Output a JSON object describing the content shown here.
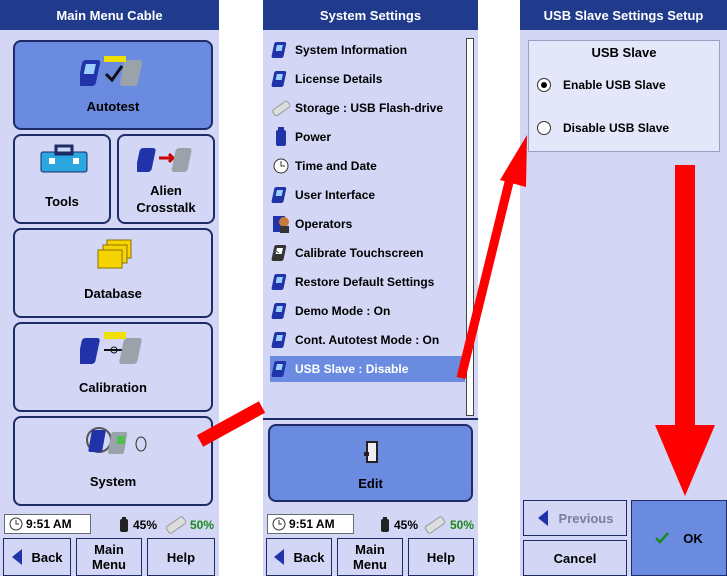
{
  "panel1": {
    "title": "Main Menu Cable",
    "buttons": [
      {
        "label": "Autotest",
        "icon": "autotest-icon"
      },
      {
        "label": "Tools",
        "icon": "toolbox-icon"
      },
      {
        "label": "Alien\nCrosstalk",
        "icon": "alien-crosstalk-icon"
      },
      {
        "label": "Database",
        "icon": "folders-icon"
      },
      {
        "label": "Calibration",
        "icon": "calibration-icon"
      },
      {
        "label": "System",
        "icon": "system-icon"
      }
    ],
    "status": {
      "time": "9:51 AM",
      "battery1": "45%",
      "battery2": "50%"
    },
    "nav": {
      "back": "Back",
      "main_menu": "Main\nMenu",
      "help": "Help"
    }
  },
  "panel2": {
    "title": "System Settings",
    "items": [
      {
        "label": "System Information",
        "icon": "handheld-icon"
      },
      {
        "label": "License Details",
        "icon": "handheld-icon"
      },
      {
        "label": "Storage : USB Flash-drive",
        "icon": "usb-drive-icon"
      },
      {
        "label": "Power",
        "icon": "battery-icon"
      },
      {
        "label": "Time and Date",
        "icon": "clock-icon"
      },
      {
        "label": "User Interface",
        "icon": "handheld-icon"
      },
      {
        "label": "Operators",
        "icon": "operator-icon"
      },
      {
        "label": "Calibrate Touchscreen",
        "icon": "touchscreen-icon"
      },
      {
        "label": "Restore Default Settings",
        "icon": "handheld-icon"
      },
      {
        "label": "Demo Mode : On",
        "icon": "handheld-icon"
      },
      {
        "label": "Cont. Autotest Mode : On",
        "icon": "handheld-icon"
      },
      {
        "label": "USB Slave : Disable",
        "icon": "handheld-icon"
      }
    ],
    "edit_label": "Edit",
    "status": {
      "time": "9:51 AM",
      "battery1": "45%",
      "battery2": "50%"
    },
    "nav": {
      "back": "Back",
      "main_menu": "Main\nMenu",
      "help": "Help"
    }
  },
  "panel3": {
    "title": "USB Slave Settings Setup",
    "group_title": "USB Slave",
    "options": [
      {
        "label": "Enable USB Slave",
        "selected": true
      },
      {
        "label": "Disable USB Slave",
        "selected": false
      }
    ],
    "previous_label": "Previous",
    "cancel_label": "Cancel",
    "ok_label": "OK"
  },
  "colors": {
    "title_bar": "#203a8c",
    "button_bg": "#d3d6f4",
    "selected": "#6b8be0",
    "arrow": "#ff0000",
    "ok_check": "#1a8a1a"
  }
}
